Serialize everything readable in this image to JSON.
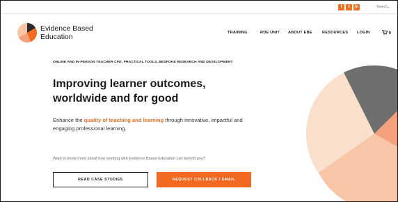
{
  "topbar": {
    "social": [
      "f",
      "t",
      "in"
    ],
    "search_placeholder": "Search..."
  },
  "brand": {
    "line1": "Evidence Based",
    "line2": "Education"
  },
  "nav": {
    "items": [
      "TRAINING",
      "RDE UNIT",
      "ABOUT EBE",
      "RESOURCES",
      "LOGIN"
    ],
    "cart_count": "0"
  },
  "hero": {
    "eyebrow": "ONLINE AND IN-PERSON TEACHER CPD, PRACTICAL TOOLS, BESPOKE RESEARCH AND DEVELOPMENT",
    "headline": "Improving learner outcomes, worldwide and for good",
    "sub_before": "Enhance the ",
    "sub_highlight": "quality of teaching and learning",
    "sub_after": " through innovative, impactful and engaging professional learning.",
    "question": "Want to know more about how working with Evidence Based Education can benefit you?",
    "btn_case": "READ CASE STUDIES",
    "btn_callback": "REQUEST CALLBACK / EMAIL"
  },
  "colors": {
    "accent": "#f26a21",
    "dark": "#1a1a1a",
    "pie_grey": "#6e6e6e",
    "pie_salmon": "#f4a07c",
    "pie_peach": "#f6c6a6",
    "pie_light": "#f9dfcc"
  }
}
